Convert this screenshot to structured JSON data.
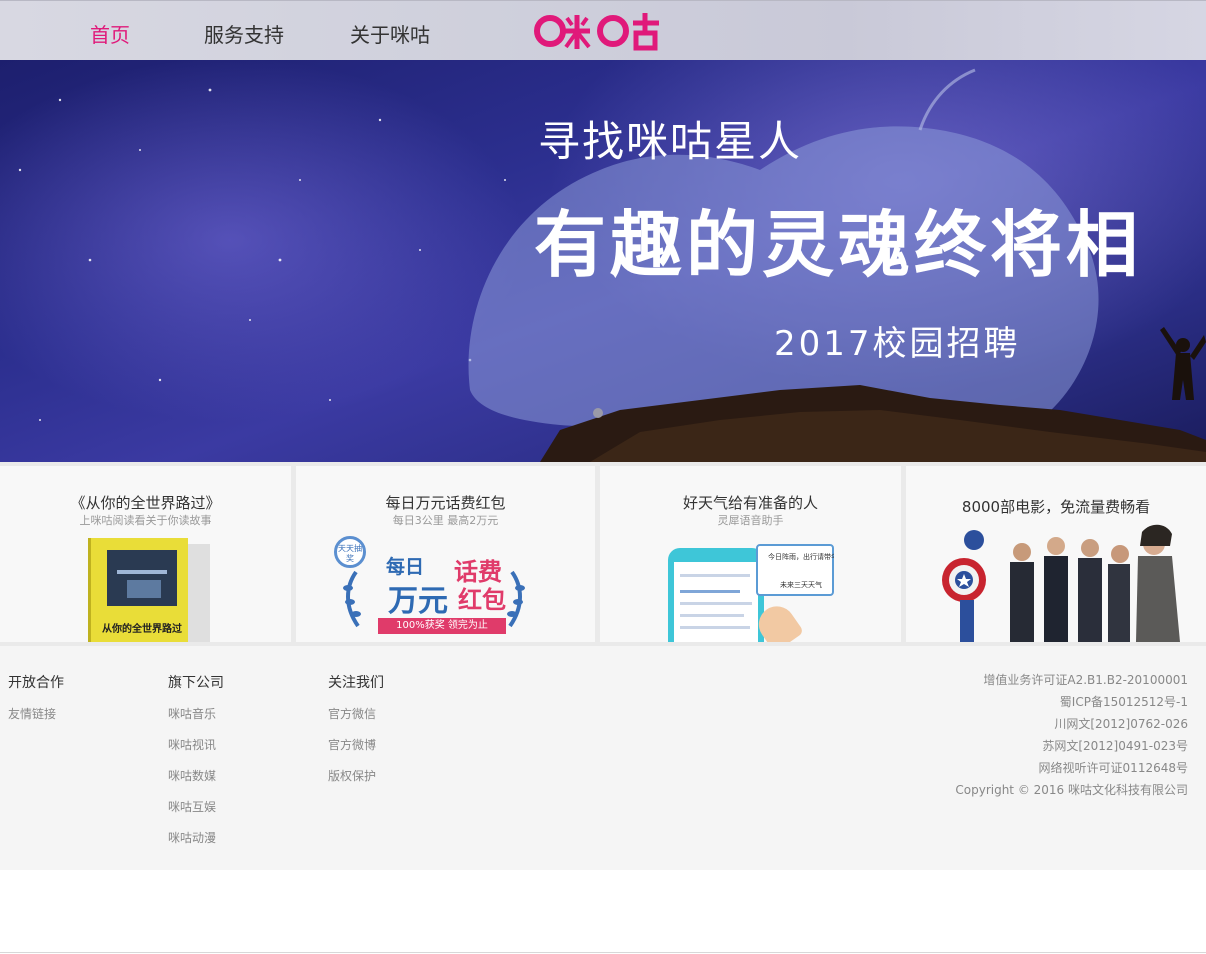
{
  "header": {
    "nav": [
      {
        "label": "首页",
        "active": true
      },
      {
        "label": "服务支持",
        "active": false
      },
      {
        "label": "关于咪咕",
        "active": false
      }
    ],
    "logo_text": "咪咕"
  },
  "banner": {
    "subtitle": "寻找咪咕星人",
    "headline": "有趣的灵魂终将相",
    "campaign": "2017校园招聘"
  },
  "cards": [
    {
      "title": "《从你的全世界路过》",
      "subtitle": "上咪咕阅读看关于你读故事",
      "book_title": "从你的全世界路过"
    },
    {
      "title": "每日万元话费红包",
      "subtitle": "每日3公里  最高2万元",
      "badge": "天天抽奖",
      "banner_line1": "每日",
      "banner_line2": "万元",
      "banner_line3": "话费",
      "banner_line4": "红包",
      "ribbon": "100%获奖  领完为止"
    },
    {
      "title": "好天气给有准备的人",
      "subtitle": "灵犀语音助手",
      "bubble_line1": "今日阵雨，出行请带伞。",
      "bubble_line2": "未来三天天气"
    },
    {
      "title": "8000部电影，免流量费畅看",
      "subtitle": ""
    }
  ],
  "footer": {
    "columns": [
      {
        "heading": "开放合作",
        "links": [
          "友情链接"
        ]
      },
      {
        "heading": "旗下公司",
        "links": [
          "咪咕音乐",
          "咪咕视讯",
          "咪咕数媒",
          "咪咕互娱",
          "咪咕动漫"
        ]
      },
      {
        "heading": "关注我们",
        "links": [
          "官方微信",
          "官方微博",
          "版权保护"
        ]
      }
    ],
    "legal": [
      "增值业务许可证A2.B1.B2-20100001",
      "蜀ICP备15012512号-1",
      "川网文[2012]0762-026",
      "苏网文[2012]0491-023号",
      "网络视听许可证0112648号",
      "Copyright © 2016 咪咕文化科技有限公司"
    ]
  },
  "colors": {
    "brand": "#e0197a",
    "banner_sky": "#2c2f8f",
    "footer_bg": "#f5f5f5"
  }
}
